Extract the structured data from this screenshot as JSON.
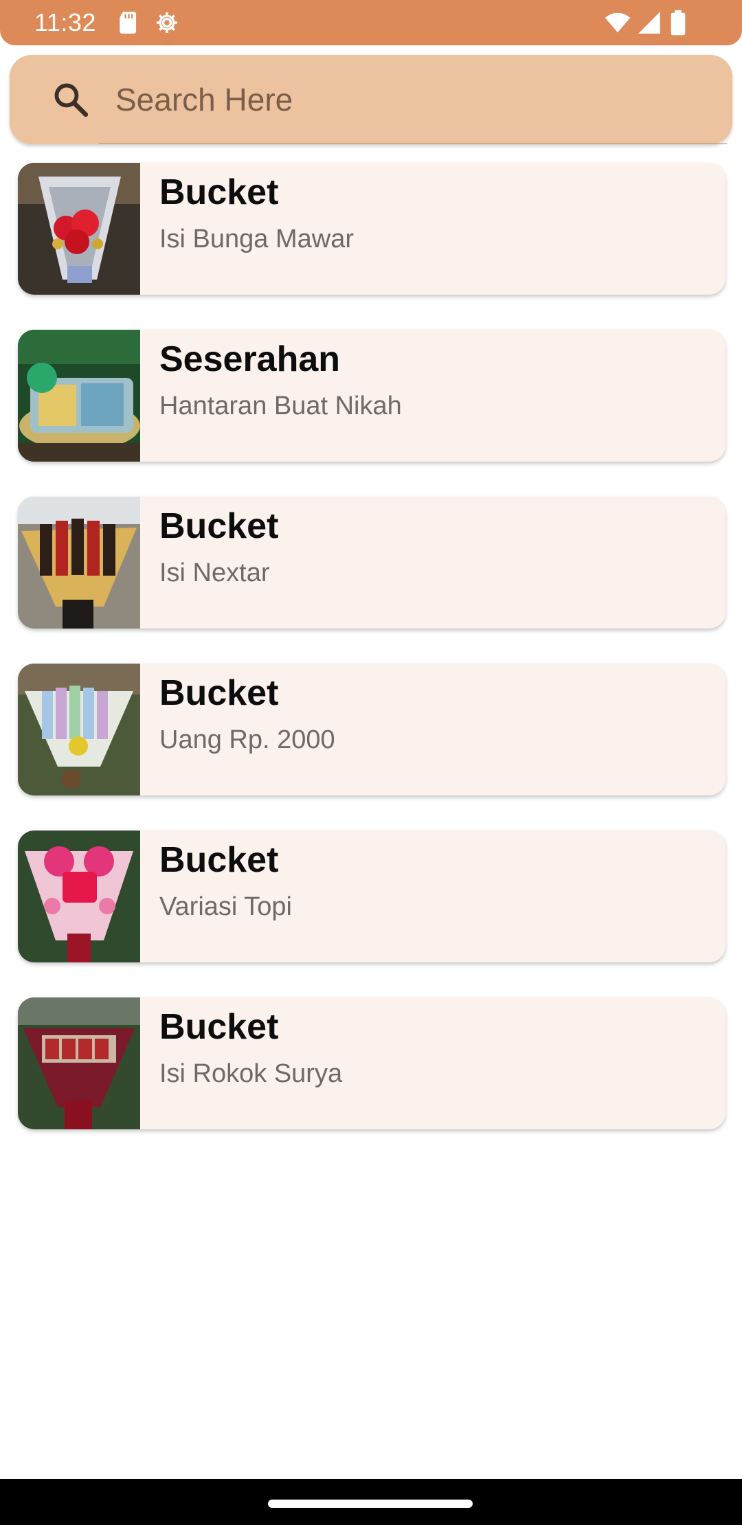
{
  "status_bar": {
    "time": "11:32",
    "icons": [
      "sd-card-icon",
      "settings-gear-icon",
      "wifi-icon",
      "cell-signal-icon",
      "battery-icon"
    ],
    "color": "#dd8a58"
  },
  "search": {
    "placeholder": "Search Here",
    "value": "",
    "background": "#ecc29f"
  },
  "items": [
    {
      "title": "Bucket",
      "subtitle": "Isi Bunga Mawar",
      "image": "red-rose-bouquet-photo"
    },
    {
      "title": "Seserahan",
      "subtitle": "Hantaran Buat Nikah",
      "image": "wedding-gift-hamper-photo"
    },
    {
      "title": "Bucket",
      "subtitle": "Isi Nextar",
      "image": "snack-bouquet-photo"
    },
    {
      "title": "Bucket",
      "subtitle": "Uang Rp. 2000",
      "image": "money-bouquet-photo"
    },
    {
      "title": "Bucket",
      "subtitle": "Variasi Topi",
      "image": "hat-bouquet-photo"
    },
    {
      "title": "Bucket",
      "subtitle": "Isi Rokok Surya",
      "image": "cigarette-bouquet-photo"
    }
  ],
  "colors": {
    "card_background": "#fbf1ed",
    "title": "#0d0d0d",
    "subtitle": "#6f6a68"
  }
}
